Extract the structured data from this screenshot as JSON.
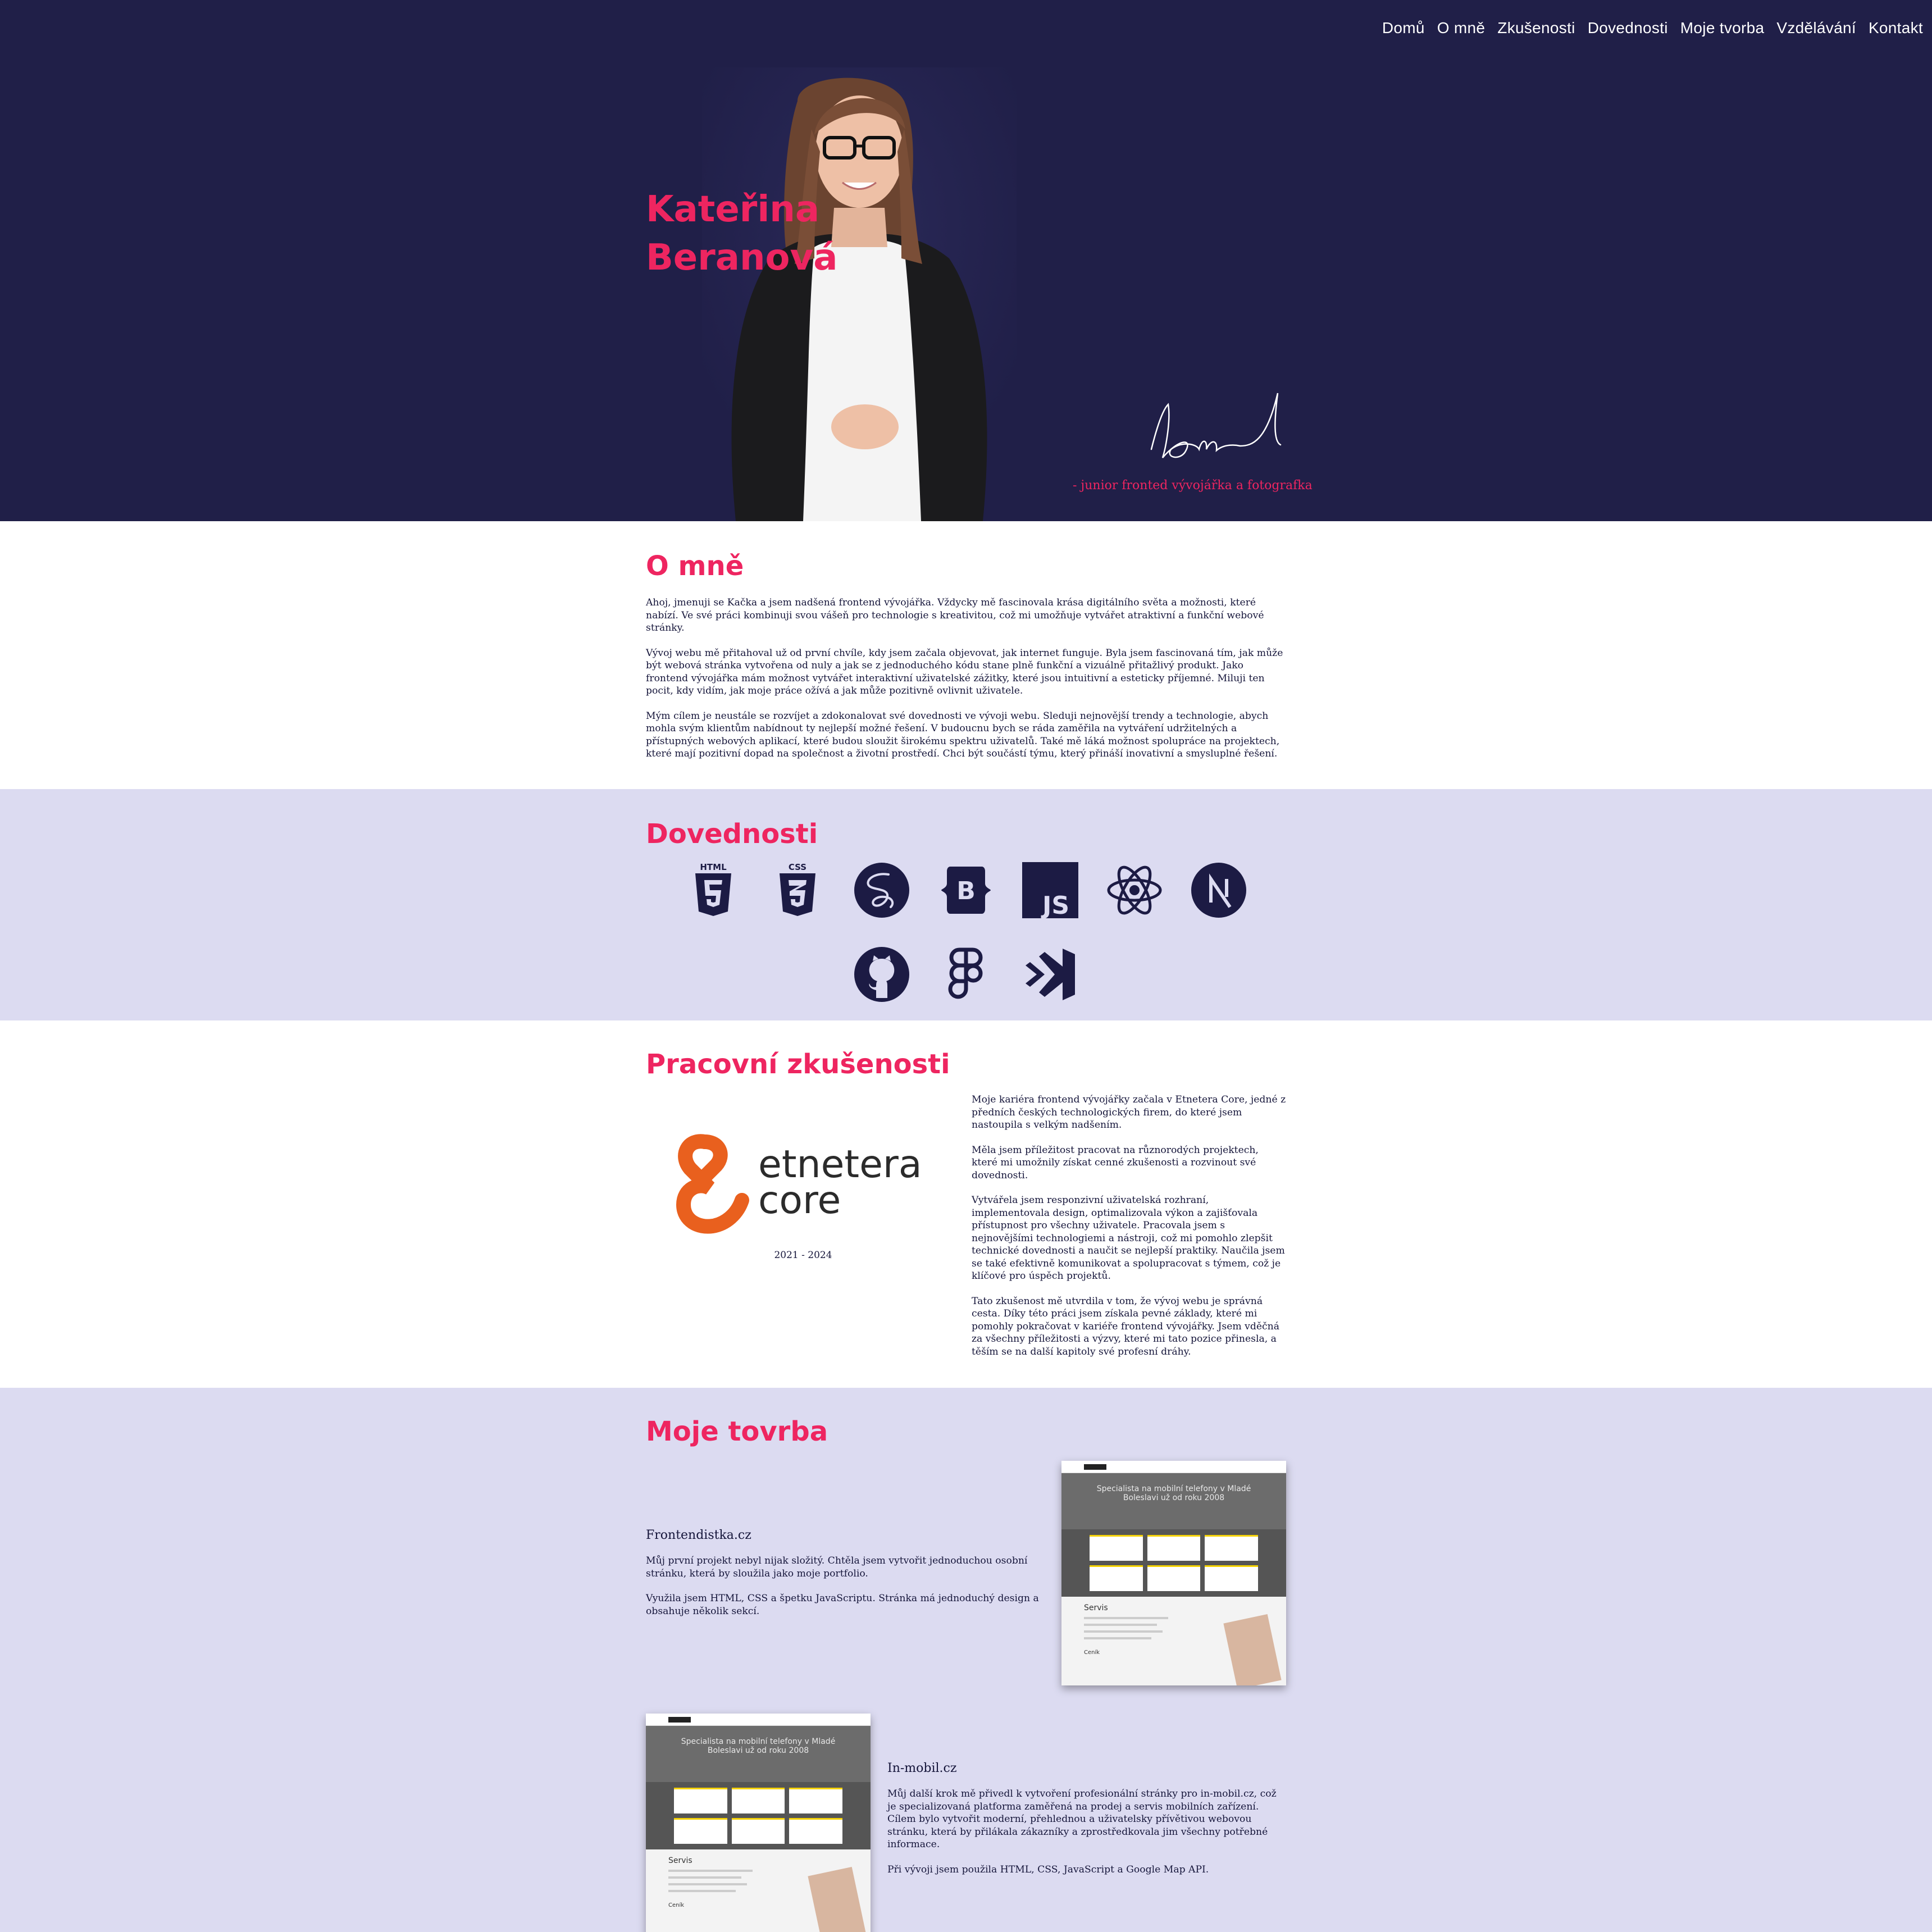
{
  "nav": {
    "items": [
      "Domů",
      "O mně",
      "Zkušenosti",
      "Dovednosti",
      "Moje tvorba",
      "Vzdělávání",
      "Kontakt"
    ]
  },
  "hero": {
    "first_name": "Kateřina",
    "last_name": "Beranová",
    "subtitle": "- junior fronted vývojářka a fotografka"
  },
  "about": {
    "title": "O mně",
    "paragraphs": [
      "Ahoj, jmenuji se Kačka a jsem nadšená frontend vývojářka. Vždycky mě fascinovala krása digitálního světa a možnosti, které nabízí. Ve své práci kombinuji svou vášeň pro technologie s kreativitou, což mi umožňuje vytvářet atraktivní a funkční webové stránky.",
      "Vývoj webu mě přitahoval už od první chvíle, kdy jsem začala objevovat, jak internet funguje. Byla jsem fascinovaná tím, jak může být webová stránka vytvořena od nuly a jak se z jednoduchého kódu stane plně funkční a vizuálně přitažlivý produkt. Jako frontend vývojářka mám možnost vytvářet interaktivní uživatelské zážitky, které jsou intuitivní a esteticky příjemné. Miluji ten pocit, kdy vidím, jak moje práce ožívá a jak může pozitivně ovlivnit uživatele.",
      "Mým cílem je neustále se rozvíjet a zdokonalovat své dovednosti ve vývoji webu. Sleduji nejnovější trendy a technologie, abych mohla svým klientům nabídnout ty nejlepší možné řešení. V budoucnu bych se ráda zaměřila na vytváření udržitelných a přístupných webových aplikací, které budou sloužit širokému spektru uživatelů. Také mě láká možnost spolupráce na projektech, které mají pozitivní dopad na společnost a životní prostředí. Chci být součástí týmu, který přináší inovativní a smysluplné řešení."
    ]
  },
  "skills": {
    "title": "Dovednosti",
    "icons": [
      "html5-icon",
      "css3-icon",
      "sass-icon",
      "bootstrap-icon",
      "javascript-icon",
      "react-icon",
      "nextjs-icon",
      "github-icon",
      "figma-icon",
      "vscode-icon"
    ],
    "icon_color": "#1c1b44"
  },
  "experience": {
    "title": "Pracovní zkušenosti",
    "logo_word_1": "etnetera",
    "logo_word_2": "core",
    "years": "2021 - 2024",
    "paragraphs": [
      "Moje kariéra frontend vývojářky začala v Etnetera Core, jedné z předních českých technologických firem, do které jsem nastoupila s velkým nadšením.",
      "Měla jsem příležitost pracovat na různorodých projektech, které mi umožnily získat cenné zkušenosti a rozvinout své dovednosti.",
      "Vytvářela jsem responzivní uživatelská rozhraní, implementovala design, optimalizovala výkon a zajišťovala přístupnost pro všechny uživatele. Pracovala jsem s nejnovějšími technologiemi a nástroji, což mi pomohlo zlepšit technické dovednosti a naučit se nejlepší praktiky. Naučila jsem se také efektivně komunikovat a spolupracovat s týmem, což je klíčové pro úspěch projektů.",
      "Tato zkušenost mě utvrdila v tom, že vývoj webu je správná cesta. Díky této práci jsem získala pevné základy, které mi pomohly pokračovat v kariéře frontend vývojářky. Jsem vděčná za všechny příležitosti a výzvy, které mi tato pozice přinesla, a těším se na další kapitoly své profesní dráhy."
    ]
  },
  "work": {
    "title": "Moje tovrba",
    "projects": [
      {
        "name": "Frontendistka.cz",
        "paragraphs": [
          "Můj první projekt nebyl nijak složitý. Chtěla jsem vytvořit jednoduchou osobní stránku, která by sloužila jako moje portfolio.",
          "Využila jsem HTML, CSS a špetku JavaScriptu. Stránka má jednoduchý design a obsahuje několik sekcí."
        ]
      },
      {
        "name": "In-mobil.cz",
        "paragraphs": [
          "Můj další krok mě přivedl k vytvoření profesionální stránky pro in-mobil.cz, což je specializovaná platforma zaměřená na prodej a servis mobilních zařízení. Cílem bylo vytvořit moderní, přehlednou a uživatelsky přívětivou webovou stránku, která by přilákala zákazníky a zprostředkovala jim všechny potřebné informace.",
          "Při vývoji jsem použila HTML, CSS, JavaScript a Google Map API."
        ]
      }
    ],
    "screenshot": {
      "hero_line_1": "Specialista na mobilní telefony v Mladé",
      "hero_line_2": "Boleslavi už od roku 2008",
      "section": "Servis",
      "price": "Ceník"
    }
  }
}
